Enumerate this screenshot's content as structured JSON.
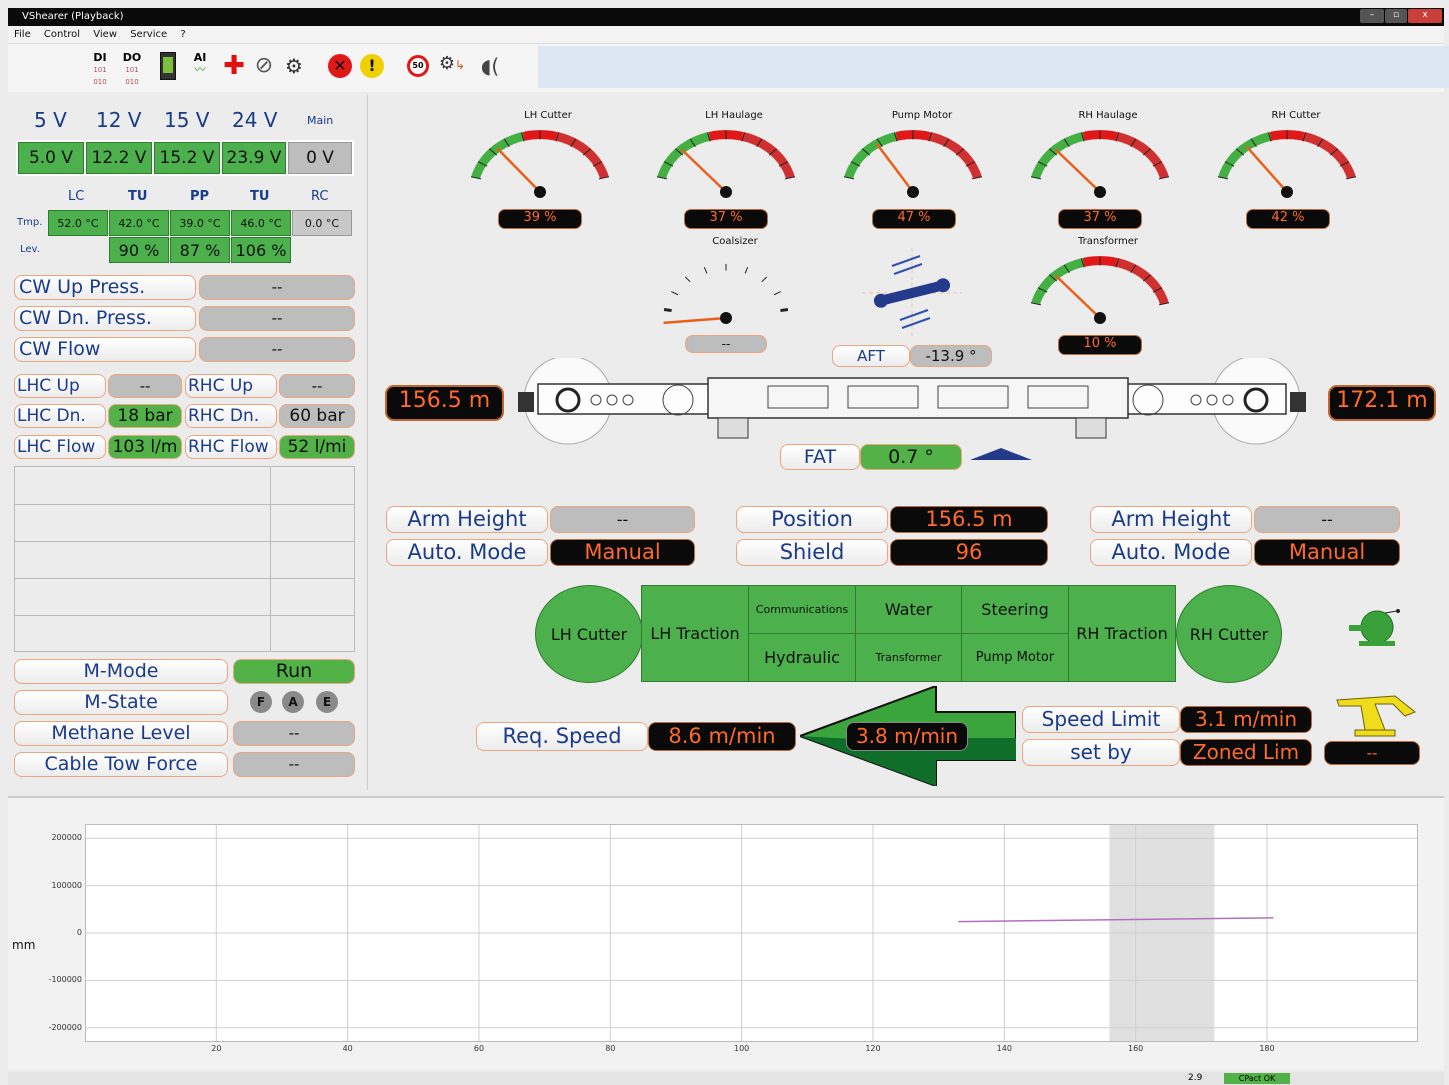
{
  "window": {
    "title": "VShearer (Playback)",
    "min": "–",
    "max": "▫",
    "close": "x"
  },
  "menu": {
    "file": "File",
    "control": "Control",
    "view": "View",
    "service": "Service",
    "help": "?"
  },
  "toolbar": {
    "di": "DI",
    "do": "DO",
    "ai": "AI",
    "speed_icon_text": "50"
  },
  "power": {
    "headers": [
      "5 V",
      "12 V",
      "15 V",
      "24 V",
      "Main"
    ],
    "values": [
      "5.0 V",
      "12.2 V",
      "15.2 V",
      "23.9 V",
      "0 V"
    ]
  },
  "temps": {
    "headers": [
      "LC",
      "TU",
      "PP",
      "TU",
      "RC"
    ],
    "row_tmp_label": "Tmp.",
    "row_lev_label": "Lev.",
    "tmp": [
      "52.0 °C",
      "42.0 °C",
      "39.0 °C",
      "46.0 °C",
      "0.0 °C"
    ],
    "lev": [
      "90 %",
      "87 %",
      "106 %"
    ]
  },
  "left": {
    "cw_up": {
      "label": "CW Up Press.",
      "value": "--"
    },
    "cw_dn": {
      "label": "CW Dn. Press.",
      "value": "--"
    },
    "cw_flow": {
      "label": "CW Flow",
      "value": "--"
    },
    "lhc_up": {
      "label": "LHC Up",
      "value": "--"
    },
    "rhc_up": {
      "label": "RHC Up",
      "value": "--"
    },
    "lhc_dn": {
      "label": "LHC Dn.",
      "value": "18 bar"
    },
    "rhc_dn": {
      "label": "RHC Dn.",
      "value": "60 bar"
    },
    "lhc_flow": {
      "label": "LHC Flow",
      "value": "103 l/m"
    },
    "rhc_flow": {
      "label": "RHC Flow",
      "value": "52 l/mi"
    },
    "m_mode": {
      "label": "M-Mode",
      "value": "Run"
    },
    "m_state": {
      "label": "M-State",
      "f": "F",
      "a": "A",
      "e": "E"
    },
    "methane": {
      "label": "Methane Level",
      "value": "--"
    },
    "cable": {
      "label": "Cable Tow Force",
      "value": "--"
    }
  },
  "gauges": [
    {
      "name": "LH Cutter",
      "value": "39 %",
      "level": 0.39
    },
    {
      "name": "LH Haulage",
      "value": "37 %",
      "level": 0.37
    },
    {
      "name": "Pump Motor",
      "value": "47 %",
      "level": 0.47
    },
    {
      "name": "RH Haulage",
      "value": "37 %",
      "level": 0.37
    },
    {
      "name": "RH Cutter",
      "value": "42 %",
      "level": 0.42
    },
    {
      "name": "Transformer",
      "value": "10 %",
      "level": 0.37
    }
  ],
  "coalsizer": {
    "name": "Coalsizer",
    "value": "--"
  },
  "aft": {
    "label": "AFT",
    "value": "-13.9 °"
  },
  "fat": {
    "label": "FAT",
    "value": "0.7 °"
  },
  "positions": {
    "left": "156.5 m",
    "right": "172.1 m"
  },
  "mid": {
    "arm_left": {
      "label": "Arm Height",
      "value": "--"
    },
    "auto_left": {
      "label": "Auto. Mode",
      "value": "Manual"
    },
    "position": {
      "label": "Position",
      "value": "156.5 m"
    },
    "shield": {
      "label": "Shield",
      "value": "96"
    },
    "arm_right": {
      "label": "Arm Height",
      "value": "--"
    },
    "auto_right": {
      "label": "Auto. Mode",
      "value": "Manual"
    }
  },
  "status_grid": {
    "lh_cutter": "LH Cutter",
    "lh_traction": "LH Traction",
    "communications": "Communications",
    "water": "Water",
    "steering": "Steering",
    "hydraulic": "Hydraulic",
    "transformer": "Transformer",
    "pump_motor": "Pump Motor",
    "rh_traction": "RH Traction",
    "rh_cutter": "RH Cutter"
  },
  "speed": {
    "req_label": "Req. Speed",
    "req_value": "8.6 m/min",
    "actual": "3.8 m/min",
    "limit_label": "Speed Limit",
    "limit_value": "3.1 m/min",
    "setby_label": "set by",
    "setby_value": "Zoned Lim",
    "extra": "--"
  },
  "chart_data": {
    "type": "line",
    "ylabel": "mm",
    "y_ticks": [
      "200000",
      "100000",
      "0",
      "-100000",
      "-200000"
    ],
    "x_ticks": [
      "20",
      "40",
      "60",
      "80",
      "100",
      "120",
      "140",
      "160",
      "180"
    ],
    "xlim": [
      0,
      203
    ],
    "ylim": [
      -230000,
      230000
    ],
    "highlight_x": [
      156,
      172
    ],
    "series": [
      {
        "x": [
          133,
          181
        ],
        "y": [
          24000,
          32000
        ]
      }
    ]
  },
  "statusbar": {
    "value": "2.9",
    "badge": "CPact OK"
  }
}
